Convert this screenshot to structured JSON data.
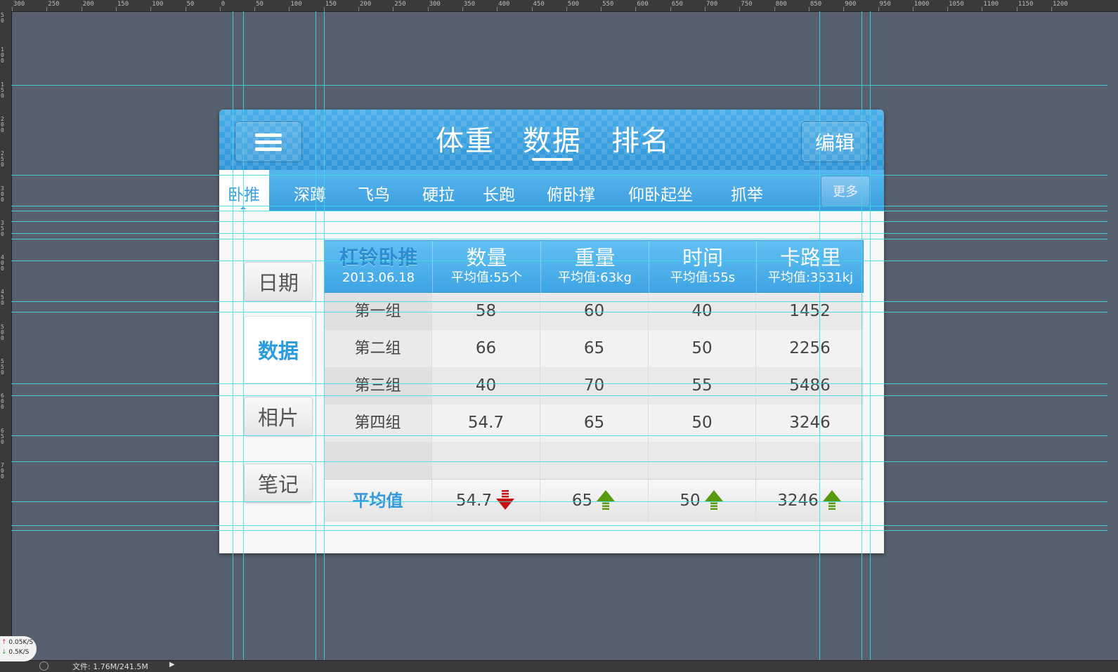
{
  "ruler": {
    "top_labels": [
      "300",
      "250",
      "200",
      "150",
      "100",
      "50",
      "0",
      "50",
      "100",
      "150",
      "200",
      "250",
      "300",
      "350",
      "400",
      "450",
      "500",
      "550",
      "600",
      "650",
      "700",
      "750",
      "800",
      "850",
      "900",
      "950",
      "1000",
      "1050",
      "1100",
      "1150",
      "1200"
    ],
    "left_labels": [
      "50",
      "100",
      "150",
      "200",
      "250",
      "300",
      "350",
      "400",
      "450",
      "500",
      "550",
      "600",
      "650",
      "700"
    ]
  },
  "header": {
    "menu_icon": "hamburger-icon",
    "tabs": [
      "体重",
      "数据",
      "排名"
    ],
    "active_tab": "数据",
    "edit_label": "编辑"
  },
  "subnav": {
    "items": [
      "卧推",
      "深蹲",
      "飞鸟",
      "硬拉",
      "长跑",
      "俯卧撑",
      "仰卧起坐",
      "抓举"
    ],
    "active": "卧推",
    "more_label": "更多"
  },
  "side": {
    "items": [
      "日期",
      "数据",
      "相片",
      "笔记"
    ],
    "active": "数据"
  },
  "table": {
    "header": {
      "title": "杠铃卧推",
      "date": "2013.06.18",
      "columns": [
        {
          "name": "数量",
          "avg": "平均值:55个"
        },
        {
          "name": "重量",
          "avg": "平均值:63kg"
        },
        {
          "name": "时间",
          "avg": "平均值:55s"
        },
        {
          "name": "卡路里",
          "avg": "平均值:3531kj"
        }
      ]
    },
    "rows": [
      {
        "label": "第一组",
        "values": [
          "58",
          "60",
          "40",
          "1452"
        ]
      },
      {
        "label": "第二组",
        "values": [
          "66",
          "65",
          "50",
          "2256"
        ]
      },
      {
        "label": "第三组",
        "values": [
          "40",
          "70",
          "55",
          "5486"
        ]
      },
      {
        "label": "第四组",
        "values": [
          "54.7",
          "65",
          "50",
          "3246"
        ]
      }
    ],
    "average": {
      "label": "平均值",
      "values": [
        "54.7",
        "65",
        "50",
        "3246"
      ],
      "trends": [
        "down",
        "up",
        "up",
        "up"
      ]
    }
  },
  "colors": {
    "accent": "#3aa2e4",
    "trend_down": "#c81010",
    "trend_up": "#5a9a10"
  },
  "statusbar": {
    "net_up": "0.05K/S",
    "net_down": "0.5K/S",
    "file_info": "文件: 1.76M/241.5M"
  }
}
